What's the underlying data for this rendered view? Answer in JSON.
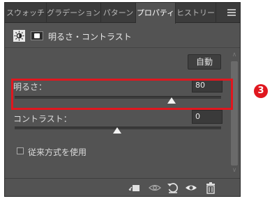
{
  "tabs": [
    {
      "label": "スウォッチ"
    },
    {
      "label": "グラデーション"
    },
    {
      "label": "パターン"
    },
    {
      "label": "プロパティ"
    },
    {
      "label": "ヒストリー"
    }
  ],
  "header": {
    "title": "明るさ・コントラスト"
  },
  "auto_button": "自動",
  "brightness": {
    "label": "明るさ：",
    "value": "80"
  },
  "contrast": {
    "label": "コントラスト：",
    "value": "0"
  },
  "legacy_checkbox": {
    "label": "従来方式を使用",
    "checked": false
  },
  "callout_number": "3",
  "icons": [
    "sun-icon",
    "layer-mask-icon",
    "clip-to-layer-icon",
    "view-previous-state-icon",
    "reset-icon",
    "visibility-icon",
    "trash-icon",
    "hamburger-menu-icon"
  ],
  "colors": {
    "panel_bg": "#535353",
    "highlight": "#e0171f"
  }
}
